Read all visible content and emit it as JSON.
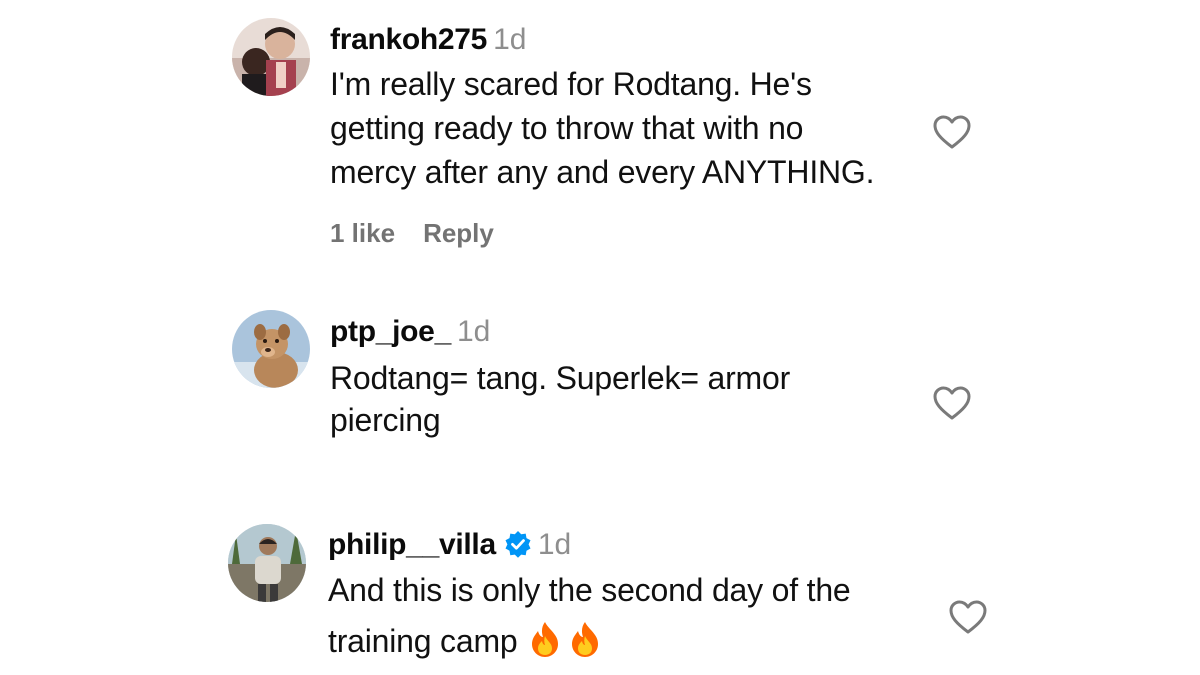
{
  "comments": [
    {
      "username": "frankoh275",
      "time": "1d",
      "verified": false,
      "lines": [
        "I'm really scared for Rodtang. He's",
        "getting ready to throw that with no",
        "mercy after any and every ANYTHING."
      ],
      "likes": "1 like",
      "reply": "Reply",
      "avatar_icon": "avatar-two-people-selfie",
      "like_icon": "heart-outline-icon"
    },
    {
      "username": "ptp_joe_",
      "time": "1d",
      "verified": false,
      "lines": [
        "Rodtang= tang. Superlek= armor",
        "piercing"
      ],
      "avatar_icon": "avatar-dog",
      "like_icon": "heart-outline-icon"
    },
    {
      "username": "philip__villa",
      "time": "1d",
      "verified": true,
      "lines": [
        "And this is only the second day of the",
        "training camp"
      ],
      "emojis": [
        "fire",
        "fire"
      ],
      "avatar_icon": "avatar-man-outdoors",
      "like_icon": "heart-outline-icon"
    }
  ],
  "colors": {
    "text": "#111111",
    "muted": "#8e8e8e",
    "verified_blue": "#0095f6"
  }
}
